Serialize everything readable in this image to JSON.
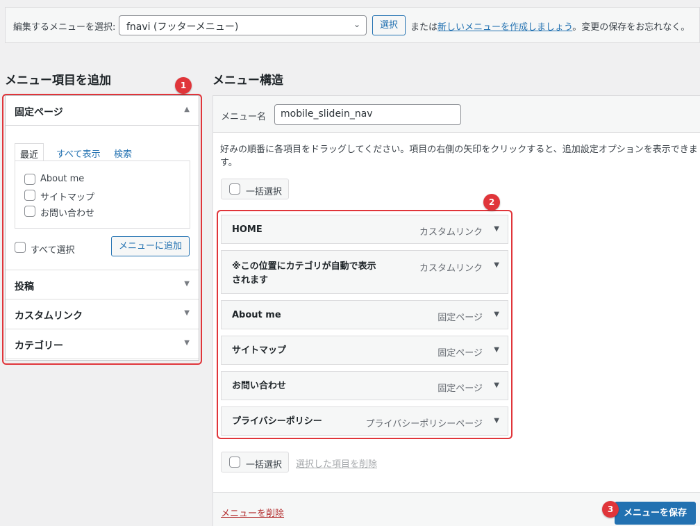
{
  "top_bar": {
    "label": "編集するメニューを選択:",
    "selected_menu": "fnavi (フッターメニュー)",
    "select_button": "選択",
    "text_before": "または",
    "create_link": "新しいメニューを作成しましょう",
    "text_after": "。変更の保存をお忘れなく。"
  },
  "left_panel": {
    "title": "メニュー項目を追加",
    "pages_section": {
      "title": "固定ページ",
      "tabs": [
        "最近",
        "すべて表示",
        "検索"
      ],
      "items": [
        "About me",
        "サイトマップ",
        "お問い合わせ"
      ],
      "select_all": "すべて選択",
      "add_button": "メニューに追加"
    },
    "other_sections": [
      "投稿",
      "カスタムリンク",
      "カテゴリー"
    ]
  },
  "right_panel": {
    "title": "メニュー構造",
    "menu_name_label": "メニュー名",
    "menu_name_value": "mobile_slidein_nav",
    "instructions": "好みの順番に各項目をドラッグしてください。項目の右側の矢印をクリックすると、追加設定オプションを表示できます。",
    "bulk_select": "一括選択",
    "menu_items": [
      {
        "title": "HOME",
        "type": "カスタムリンク"
      },
      {
        "title": "※この位置にカテゴリが自動で表示されます",
        "type": "カスタムリンク"
      },
      {
        "title": "About me",
        "type": "固定ページ"
      },
      {
        "title": "サイトマップ",
        "type": "固定ページ"
      },
      {
        "title": "お問い合わせ",
        "type": "固定ページ"
      },
      {
        "title": "プライバシーポリシー",
        "type": "プライバシーポリシーページ"
      }
    ],
    "delete_selected": "選択した項目を削除",
    "delete_menu": "メニューを削除",
    "save_button": "メニューを保存"
  },
  "annotations": [
    "1",
    "2",
    "3"
  ],
  "colors": {
    "accent": "#2271b1",
    "highlight": "#e0353a",
    "danger": "#b32d2e"
  }
}
